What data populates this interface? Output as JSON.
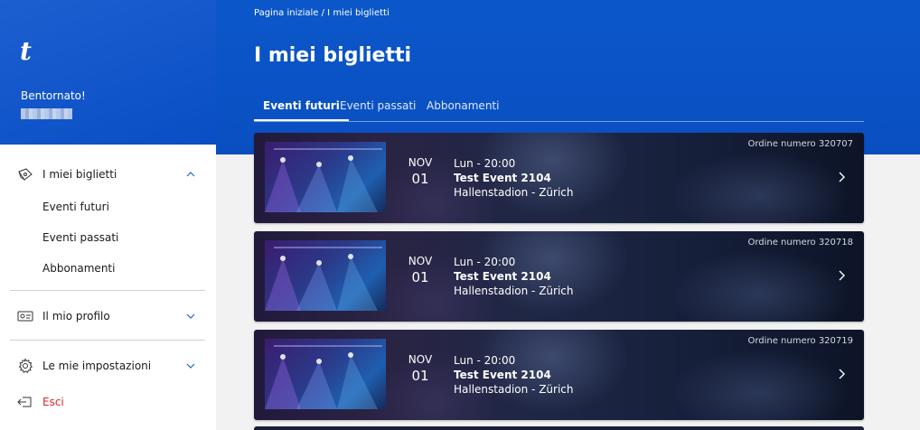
{
  "sidebar": {
    "logo": "t",
    "welcome": "Bentornato!",
    "nav": [
      {
        "label": "I miei biglietti",
        "icon": "tickets-icon",
        "expanded": true,
        "children": [
          "Eventi futuri",
          "Eventi passati",
          "Abbonamenti"
        ]
      },
      {
        "label": "Il mio profilo",
        "icon": "profile-card-icon",
        "expanded": false
      },
      {
        "label": "Le mie impostazioni",
        "icon": "gear-icon",
        "expanded": false
      },
      {
        "label": "Esci",
        "icon": "logout-icon",
        "color": "#d9242c"
      }
    ]
  },
  "header": {
    "breadcrumb": "Pagina iniziale / I miei biglietti",
    "title": "I miei biglietti",
    "tabs": [
      "Eventi futuri",
      "Eventi passati",
      "Abbonamenti"
    ],
    "active_tab": "Eventi futuri"
  },
  "events": [
    {
      "month": "NOV",
      "day": "01",
      "when": "Lun - 20:00",
      "name": "Test Event 2104",
      "venue": "Hallenstadion - Zürich",
      "order": "Ordine numero 320707"
    },
    {
      "month": "NOV",
      "day": "01",
      "when": "Lun - 20:00",
      "name": "Test Event 2104",
      "venue": "Hallenstadion - Zürich",
      "order": "Ordine numero 320718"
    },
    {
      "month": "NOV",
      "day": "01",
      "when": "Lun - 20:00",
      "name": "Test Event 2104",
      "venue": "Hallenstadion - Zürich",
      "order": "Ordine numero 320719"
    }
  ],
  "colors": {
    "brand_blue": "#0a4fc2",
    "logout_red": "#d9242c",
    "chevron_blue": "#1e63d6"
  }
}
